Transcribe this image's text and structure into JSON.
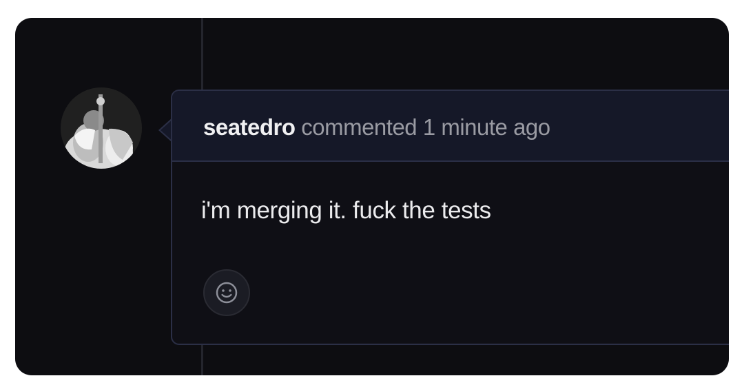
{
  "comment": {
    "author": "seatedro",
    "action": "commented",
    "timestamp": "1 minute ago",
    "body": "i'm merging it. fuck the tests"
  },
  "icons": {
    "avatar": "user-avatar",
    "reaction": "smiley-face-icon"
  },
  "colors": {
    "background": "#0d0d11",
    "header_background": "#151828",
    "border": "#2b2f46",
    "author_text": "#f0f0f2",
    "meta_text": "#9a9ba3",
    "body_text": "#ececee"
  }
}
